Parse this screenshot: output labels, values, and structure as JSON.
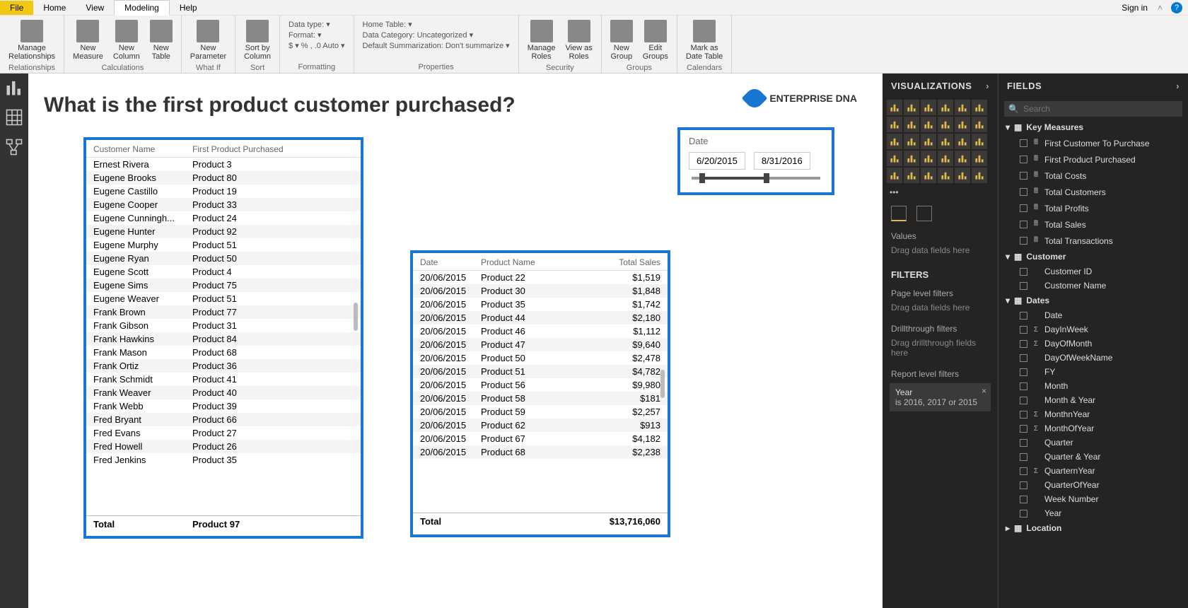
{
  "menubar": {
    "file": "File",
    "home": "Home",
    "view": "View",
    "modeling": "Modeling",
    "help": "Help",
    "signin": "Sign in"
  },
  "ribbon": {
    "relationships": {
      "manage": "Manage\nRelationships",
      "group": "Relationships"
    },
    "calculations": {
      "measure": "New\nMeasure",
      "column": "New\nColumn",
      "table": "New\nTable",
      "group": "Calculations"
    },
    "whatif": {
      "param": "New\nParameter",
      "group": "What If"
    },
    "sort": {
      "sortby": "Sort by\nColumn",
      "group": "Sort"
    },
    "formatting": {
      "datatype": "Data type: ▾",
      "format": "Format: ▾",
      "row3": "$ ▾  %  ,  .0  Auto ▾",
      "group": "Formatting"
    },
    "properties": {
      "hometable": "Home Table: ▾",
      "datacat": "Data Category: Uncategorized ▾",
      "summ": "Default Summarization: Don't summarize ▾",
      "group": "Properties"
    },
    "security": {
      "manage": "Manage\nRoles",
      "viewas": "View as\nRoles",
      "group": "Security"
    },
    "groups": {
      "new": "New\nGroup",
      "edit": "Edit\nGroups",
      "group": "Groups"
    },
    "calendars": {
      "mark": "Mark as\nDate Table",
      "group": "Calendars"
    }
  },
  "canvas": {
    "title": "What is the first product customer purchased?",
    "logo": "ENTERPRISE DNA"
  },
  "table1": {
    "headers": [
      "Customer Name",
      "First Product Purchased"
    ],
    "rows": [
      [
        "Ernest Rivera",
        "Product 3"
      ],
      [
        "Eugene Brooks",
        "Product 80"
      ],
      [
        "Eugene Castillo",
        "Product 19"
      ],
      [
        "Eugene Cooper",
        "Product 33"
      ],
      [
        "Eugene Cunningh...",
        "Product 24"
      ],
      [
        "Eugene Hunter",
        "Product 92"
      ],
      [
        "Eugene Murphy",
        "Product 51"
      ],
      [
        "Eugene Ryan",
        "Product 50"
      ],
      [
        "Eugene Scott",
        "Product 4"
      ],
      [
        "Eugene Sims",
        "Product 75"
      ],
      [
        "Eugene Weaver",
        "Product 51"
      ],
      [
        "Frank Brown",
        "Product 77"
      ],
      [
        "Frank Gibson",
        "Product 31"
      ],
      [
        "Frank Hawkins",
        "Product 84"
      ],
      [
        "Frank Mason",
        "Product 68"
      ],
      [
        "Frank Ortiz",
        "Product 36"
      ],
      [
        "Frank Schmidt",
        "Product 41"
      ],
      [
        "Frank Weaver",
        "Product 40"
      ],
      [
        "Frank Webb",
        "Product 39"
      ],
      [
        "Fred Bryant",
        "Product 66"
      ],
      [
        "Fred Evans",
        "Product 27"
      ],
      [
        "Fred Howell",
        "Product 26"
      ],
      [
        "Fred Jenkins",
        "Product 35"
      ]
    ],
    "footer": [
      "Total",
      "Product 97"
    ]
  },
  "table2": {
    "headers": [
      "Date",
      "Product Name",
      "Total Sales"
    ],
    "rows": [
      [
        "20/06/2015",
        "Product 22",
        "$1,519"
      ],
      [
        "20/06/2015",
        "Product 30",
        "$1,848"
      ],
      [
        "20/06/2015",
        "Product 35",
        "$1,742"
      ],
      [
        "20/06/2015",
        "Product 44",
        "$2,180"
      ],
      [
        "20/06/2015",
        "Product 46",
        "$1,112"
      ],
      [
        "20/06/2015",
        "Product 47",
        "$9,640"
      ],
      [
        "20/06/2015",
        "Product 50",
        "$2,478"
      ],
      [
        "20/06/2015",
        "Product 51",
        "$4,782"
      ],
      [
        "20/06/2015",
        "Product 56",
        "$9,980"
      ],
      [
        "20/06/2015",
        "Product 58",
        "$181"
      ],
      [
        "20/06/2015",
        "Product 59",
        "$2,257"
      ],
      [
        "20/06/2015",
        "Product 62",
        "$913"
      ],
      [
        "20/06/2015",
        "Product 67",
        "$4,182"
      ],
      [
        "20/06/2015",
        "Product 68",
        "$2,238"
      ]
    ],
    "footer": [
      "Total",
      "",
      "$13,716,060"
    ]
  },
  "slicer": {
    "title": "Date",
    "from": "6/20/2015",
    "to": "8/31/2016"
  },
  "viz": {
    "header": "VISUALIZATIONS",
    "values": "Values",
    "valueshint": "Drag data fields here",
    "filters_header": "FILTERS",
    "page_filters": "Page level filters",
    "page_hint": "Drag data fields here",
    "drill": "Drillthrough filters",
    "drill_hint": "Drag drillthrough fields here",
    "report_filters": "Report level filters",
    "applied_name": "Year",
    "applied_value": "is 2016, 2017 or 2015"
  },
  "fields": {
    "header": "FIELDS",
    "search_placeholder": "Search",
    "tables": [
      {
        "name": "Key Measures",
        "expanded": true,
        "fields": [
          {
            "name": "First Customer To Purchase",
            "type": "m"
          },
          {
            "name": "First Product Purchased",
            "type": "m"
          },
          {
            "name": "Total Costs",
            "type": "m"
          },
          {
            "name": "Total Customers",
            "type": "m"
          },
          {
            "name": "Total Profits",
            "type": "m"
          },
          {
            "name": "Total Sales",
            "type": "m"
          },
          {
            "name": "Total Transactions",
            "type": "m"
          }
        ]
      },
      {
        "name": "Customer",
        "expanded": true,
        "fields": [
          {
            "name": "Customer ID",
            "type": ""
          },
          {
            "name": "Customer Name",
            "type": ""
          }
        ]
      },
      {
        "name": "Dates",
        "expanded": true,
        "fields": [
          {
            "name": "Date",
            "type": ""
          },
          {
            "name": "DayInWeek",
            "type": "Σ"
          },
          {
            "name": "DayOfMonth",
            "type": "Σ"
          },
          {
            "name": "DayOfWeekName",
            "type": ""
          },
          {
            "name": "FY",
            "type": ""
          },
          {
            "name": "Month",
            "type": ""
          },
          {
            "name": "Month & Year",
            "type": ""
          },
          {
            "name": "MonthnYear",
            "type": "Σ"
          },
          {
            "name": "MonthOfYear",
            "type": "Σ"
          },
          {
            "name": "Quarter",
            "type": ""
          },
          {
            "name": "Quarter & Year",
            "type": ""
          },
          {
            "name": "QuarternYear",
            "type": "Σ"
          },
          {
            "name": "QuarterOfYear",
            "type": ""
          },
          {
            "name": "Week Number",
            "type": ""
          },
          {
            "name": "Year",
            "type": ""
          }
        ]
      },
      {
        "name": "Location",
        "expanded": false,
        "fields": []
      }
    ]
  }
}
